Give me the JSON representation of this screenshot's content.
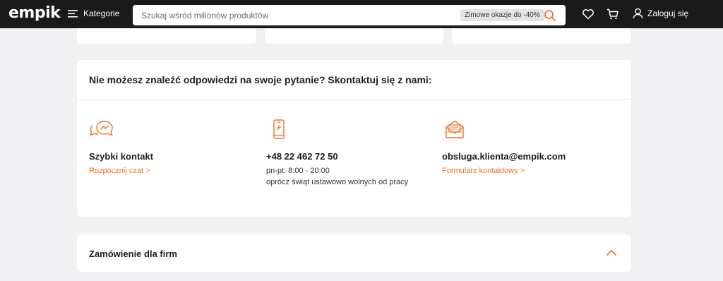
{
  "header": {
    "logo": "empik",
    "categories_label": "Kategorie",
    "search_placeholder": "Szukaj wśród milionów produktów",
    "promo_badge": "Zimowe okazje do -40%",
    "login_label": "Zaloguj się"
  },
  "contact": {
    "heading": "Nie możesz znaleźć odpowiedzi na swoje pytanie? Skontaktuj się z nami:",
    "chat": {
      "title": "Szybki kontakt",
      "link": "Rozpocznij czat >"
    },
    "phone": {
      "title": "+48 22 462 72 50",
      "hours": "pn-pt: 8:00 - 20:00",
      "note": "oprócz świąt ustawowo wolnych od pracy"
    },
    "email": {
      "title": "obsluga.klienta@empik.com",
      "link": "Formularz kontaktowy >"
    }
  },
  "firms": {
    "title": "Zamówienie dla firm"
  },
  "colors": {
    "accent": "#f37021",
    "header_bg": "#1a1a1a",
    "page_bg": "#f1f1f4"
  },
  "icons": [
    "hamburger-icon",
    "search-icon",
    "heart-icon",
    "cart-icon",
    "user-icon",
    "chat-icon",
    "phone-icon",
    "envelope-icon",
    "chevron-up-icon"
  ]
}
